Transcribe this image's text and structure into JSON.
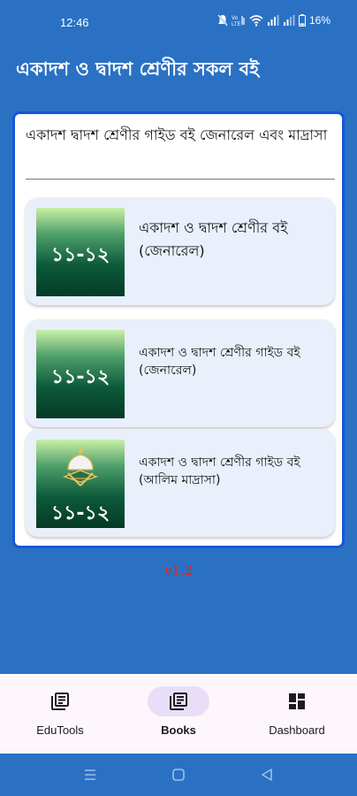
{
  "status_bar": {
    "time": "12:46",
    "battery_percent": "16%",
    "icons": [
      "mute-icon",
      "data-icon",
      "wifi-icon",
      "signal-icon",
      "signal-icon-2",
      "battery-icon"
    ],
    "data_label": "Vo LTE"
  },
  "app_bar": {
    "title": "একাদশ ও দ্বাদশ শ্রেণীর সকল বই"
  },
  "card": {
    "heading": "একাদশ দ্বাদশ শ্রেণীর গাইড বই জেনারেল এবং মাদ্রাসা",
    "items": [
      {
        "thumb_label": "১১-১২",
        "title_line1": "একাদশ ও দ্বাদশ শ্রেণীর বই",
        "title_line2": "(জেনারেল)",
        "icon": "book-thumbnail"
      },
      {
        "thumb_label": "১১-১২",
        "title_line1": "একাদশ ও দ্বাদশ শ্রেণীর গাইড বই",
        "title_line2": "(জেনারেল)",
        "icon": "book-thumbnail"
      },
      {
        "thumb_label": "১১-১২",
        "title_line1": "একাদশ ও দ্বাদশ শ্রেণীর গাইড বই",
        "title_line2": "(আলিম মাদ্রাসা)",
        "icon": "mosque-quran-icon"
      }
    ]
  },
  "version": "v1.2",
  "bottom_nav": {
    "items": [
      {
        "label": "EduTools",
        "icon": "library-books-icon",
        "selected": false
      },
      {
        "label": "Books",
        "icon": "library-books-icon",
        "selected": true
      },
      {
        "label": "Dashboard",
        "icon": "dashboard-icon",
        "selected": false
      }
    ]
  },
  "system_nav": {
    "buttons": [
      "recents-icon",
      "home-icon",
      "back-icon"
    ]
  },
  "colors": {
    "primary": "#2a71c4",
    "card_border": "#1557d9",
    "item_bg": "#e9f0fb",
    "version_text": "#d9281e",
    "nav_bg": "#fdf6fa",
    "nav_pill": "#e8def8"
  }
}
